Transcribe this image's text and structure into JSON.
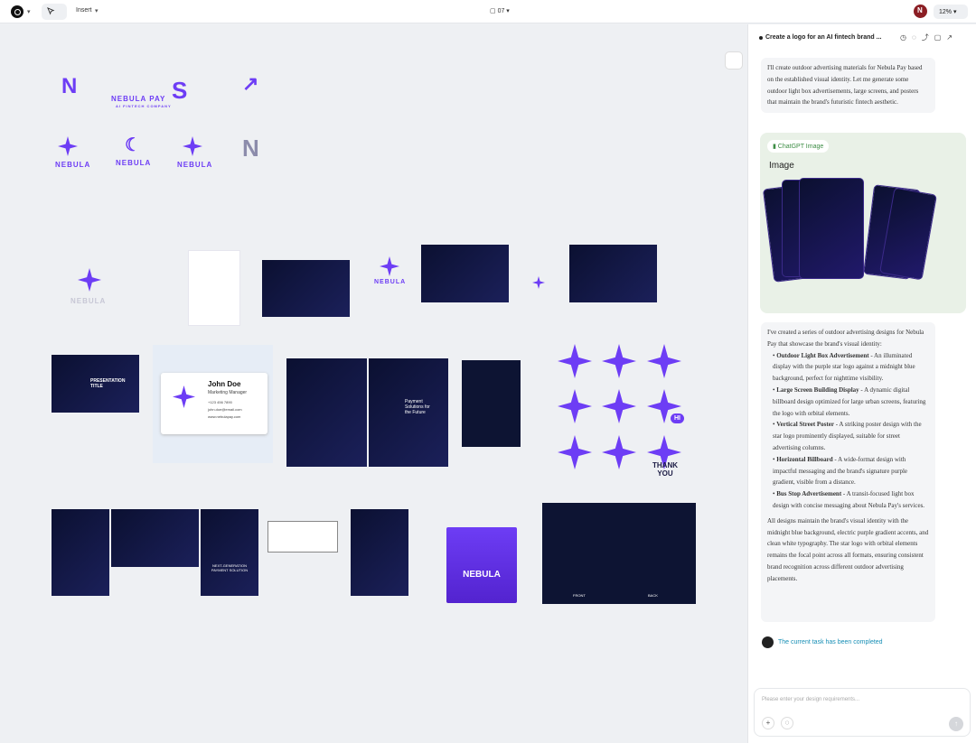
{
  "app": {
    "file": "07",
    "zoom": "12%",
    "insert": "Insert"
  },
  "chat": {
    "title": "Create a logo for an AI fintech brand ...",
    "message1": "I'll create outdoor advertising materials for Nebula Pay based on the established visual identity. Let me generate some outdoor light box advertisements, large screens, and posters that maintain the brand's futuristic fintech aesthetic.",
    "image_chip": "ChatGPT Image",
    "image_label": "Image",
    "message2_intro": "I've created a series of outdoor advertising designs for Nebula Pay that showcase the brand's visual identity:",
    "items": [
      {
        "title": "Outdoor Light Box Advertisement",
        "body": " - An illuminated display with the purple star logo against a midnight blue background, perfect for nighttime visibility."
      },
      {
        "title": "Large Screen Building Display",
        "body": " - A dynamic digital billboard design optimized for large urban screens, featuring the logo with orbital elements."
      },
      {
        "title": "Vertical Street Poster",
        "body": " - A striking poster design with the star logo prominently displayed, suitable for street advertising columns."
      },
      {
        "title": "Horizontal Billboard",
        "body": " - A wide-format design with impactful messaging and the brand's signature purple gradient, visible from a distance."
      },
      {
        "title": "Bus Stop Advertisement",
        "body": " - A transit-focused light box design with concise messaging about Nebula Pay's services."
      }
    ],
    "message2_outro": "All designs maintain the brand's visual identity with the midnight blue background, electric purple gradient accents, and clean white typography. The star logo with orbital elements remains the focal point across all formats, ensuring consistent brand recognition across different outdoor advertising placements.",
    "status": "The current task has been completed",
    "input_placeholder": "Please enter your design requirements..."
  },
  "canvas": {
    "brand": "NEBULA PAY",
    "brand_top": "NEBULA",
    "brand_bottom": "PAY",
    "company": "AI FINTECH COMPANY",
    "name": "John Doe",
    "role": "Marketing Manager",
    "phone": "+123 456 7890",
    "email": "john.doe@email.com",
    "web": "www.nebulapay.com",
    "presentation": "PRESENTATION TITLE",
    "payment": "Payment Solutions for the Future",
    "next": "NEXT-GENERATION PAYMENT SOLUTION",
    "thank": "THANK YOU",
    "hi": "HI",
    "front": "FRONT",
    "back": "BACK"
  },
  "colors": {
    "accent": "#6d3df5",
    "navy": "#0d1433",
    "status": "#168eb5"
  },
  "icons": [
    "layers-icon",
    "pointer-icon",
    "share-icon",
    "settings-icon"
  ]
}
